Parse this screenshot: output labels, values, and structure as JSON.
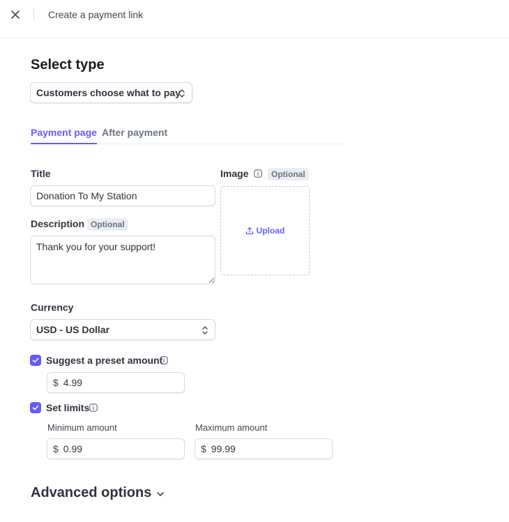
{
  "header": {
    "title": "Create a payment link",
    "close_icon": "close-icon"
  },
  "select_type": {
    "heading": "Select type",
    "selected": "Customers choose what to pay"
  },
  "tabs": [
    {
      "label": "Payment page",
      "active": true
    },
    {
      "label": "After payment",
      "active": false
    }
  ],
  "form": {
    "title_label": "Title",
    "title_value": "Donation To My Station",
    "description_label": "Description",
    "description_badge": "Optional",
    "description_value": "Thank you for your support!",
    "image_label": "Image",
    "image_badge": "Optional",
    "upload_label": "Upload",
    "currency_label": "Currency",
    "currency_value": "USD - US Dollar",
    "suggest_label": "Suggest a preset amount",
    "suggest_checked": true,
    "preset_currency": "$",
    "preset_amount": "4.99",
    "limits_label": "Set limits",
    "limits_checked": true,
    "min_label": "Minimum amount",
    "min_currency": "$",
    "min_amount": "0.99",
    "max_label": "Maximum amount",
    "max_currency": "$",
    "max_amount": "99.99"
  },
  "advanced": {
    "label": "Advanced options"
  },
  "colors": {
    "accent": "#635bff",
    "text": "#30313d",
    "muted": "#687385",
    "border": "#d5dbe1"
  }
}
